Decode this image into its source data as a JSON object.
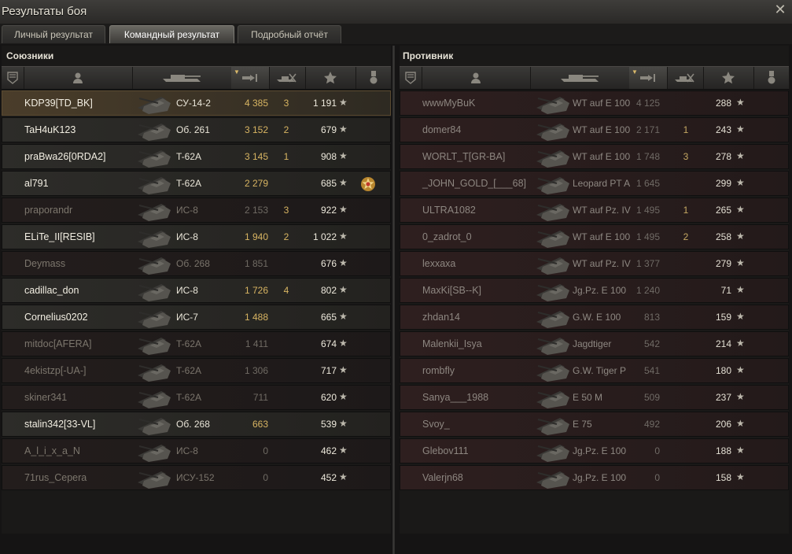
{
  "window": {
    "title": "Результаты боя"
  },
  "tabs": [
    {
      "label": "Личный результат"
    },
    {
      "label": "Командный результат"
    },
    {
      "label": "Подробный отчёт"
    }
  ],
  "allies": {
    "title": "Союзники",
    "rows": [
      {
        "name": "KDP39[TD_BK]",
        "vehicle": "СУ-14-2",
        "damage": "4 385",
        "frags": "3",
        "xp": "1 191"
      },
      {
        "name": "TaH4uK123",
        "vehicle": "Об. 261",
        "damage": "3 152",
        "frags": "2",
        "xp": "679"
      },
      {
        "name": "praBwa26[0RDA2]",
        "vehicle": "T-62A",
        "damage": "3 145",
        "frags": "1",
        "xp": "908"
      },
      {
        "name": "al791",
        "vehicle": "T-62A",
        "damage": "2 279",
        "frags": "",
        "xp": "685"
      },
      {
        "name": "praporandr",
        "vehicle": "ИС-8",
        "damage": "2 153",
        "frags": "3",
        "xp": "922"
      },
      {
        "name": "ELiTe_II[RESIB]",
        "vehicle": "ИС-8",
        "damage": "1 940",
        "frags": "2",
        "xp": "1 022"
      },
      {
        "name": "Deymass",
        "vehicle": "Об. 268",
        "damage": "1 851",
        "frags": "",
        "xp": "676"
      },
      {
        "name": "cadillac_don",
        "vehicle": "ИС-8",
        "damage": "1 726",
        "frags": "4",
        "xp": "802"
      },
      {
        "name": "Cornelius0202",
        "vehicle": "ИС-7",
        "damage": "1 488",
        "frags": "",
        "xp": "665"
      },
      {
        "name": "mitdoc[AFERA]",
        "vehicle": "T-62A",
        "damage": "1 411",
        "frags": "",
        "xp": "674"
      },
      {
        "name": "4ekistzp[-UA-]",
        "vehicle": "T-62A",
        "damage": "1 306",
        "frags": "",
        "xp": "717"
      },
      {
        "name": "skiner341",
        "vehicle": "T-62A",
        "damage": "711",
        "frags": "",
        "xp": "620"
      },
      {
        "name": "stalin342[33-VL]",
        "vehicle": "Об. 268",
        "damage": "663",
        "frags": "",
        "xp": "539"
      },
      {
        "name": "A_l_i_x_a_N",
        "vehicle": "ИС-8",
        "damage": "0",
        "frags": "",
        "xp": "462"
      },
      {
        "name": "71rus_Cepera",
        "vehicle": "ИСУ-152",
        "damage": "0",
        "frags": "",
        "xp": "452"
      }
    ]
  },
  "enemies": {
    "title": "Противник",
    "rows": [
      {
        "name": "wwwMyBuK",
        "vehicle": "WT auf E 100",
        "damage": "4 125",
        "frags": "",
        "xp": "288"
      },
      {
        "name": "domer84",
        "vehicle": "WT auf E 100",
        "damage": "2 171",
        "frags": "1",
        "xp": "243"
      },
      {
        "name": "WORLT_T[GR-BA]",
        "vehicle": "WT auf E 100",
        "damage": "1 748",
        "frags": "3",
        "xp": "278"
      },
      {
        "name": "_JOHN_GOLD_[___68]",
        "vehicle": "Leopard PT A",
        "damage": "1 645",
        "frags": "",
        "xp": "299"
      },
      {
        "name": "ULTRA1082",
        "vehicle": "WT auf Pz. IV",
        "damage": "1 495",
        "frags": "1",
        "xp": "265"
      },
      {
        "name": "0_zadrot_0",
        "vehicle": "WT auf E 100",
        "damage": "1 495",
        "frags": "2",
        "xp": "258"
      },
      {
        "name": "lexxaxa",
        "vehicle": "WT auf Pz. IV",
        "damage": "1 377",
        "frags": "",
        "xp": "279"
      },
      {
        "name": "MaxKi[SB--K]",
        "vehicle": "Jg.Pz. E 100",
        "damage": "1 240",
        "frags": "",
        "xp": "71"
      },
      {
        "name": "zhdan14",
        "vehicle": "G.W. E 100",
        "damage": "813",
        "frags": "",
        "xp": "159"
      },
      {
        "name": "Malenkii_Isya",
        "vehicle": "Jagdtiger",
        "damage": "542",
        "frags": "",
        "xp": "214"
      },
      {
        "name": "rombfly",
        "vehicle": "G.W. Tiger P",
        "damage": "541",
        "frags": "",
        "xp": "180"
      },
      {
        "name": "Sanya___1988",
        "vehicle": "E 50 M",
        "damage": "509",
        "frags": "",
        "xp": "237"
      },
      {
        "name": "Svoy_",
        "vehicle": "E 75",
        "damage": "492",
        "frags": "",
        "xp": "206"
      },
      {
        "name": "Glebov111",
        "vehicle": "Jg.Pz. E 100",
        "damage": "0",
        "frags": "",
        "xp": "188"
      },
      {
        "name": "Valerjn68",
        "vehicle": "Jg.Pz. E 100",
        "damage": "0",
        "frags": "",
        "xp": "158"
      }
    ]
  },
  "icons": {
    "xp_star": "★",
    "close": "✕",
    "column_icons": [
      "badge-icon",
      "player-icon",
      "tank-icon",
      "damage-icon",
      "frags-icon",
      "xp-icon",
      "medal-icon"
    ]
  },
  "state": {
    "active_tab": 1,
    "ally_dead_rows": [
      4,
      6,
      9,
      10,
      11,
      13,
      14
    ],
    "medal_row": 3,
    "highlight_row": 0
  },
  "colors": {
    "accent_gold": "#d7b462",
    "ally_text": "#f2eee2",
    "enemy_text": "#8d8680",
    "background": "#151414"
  }
}
